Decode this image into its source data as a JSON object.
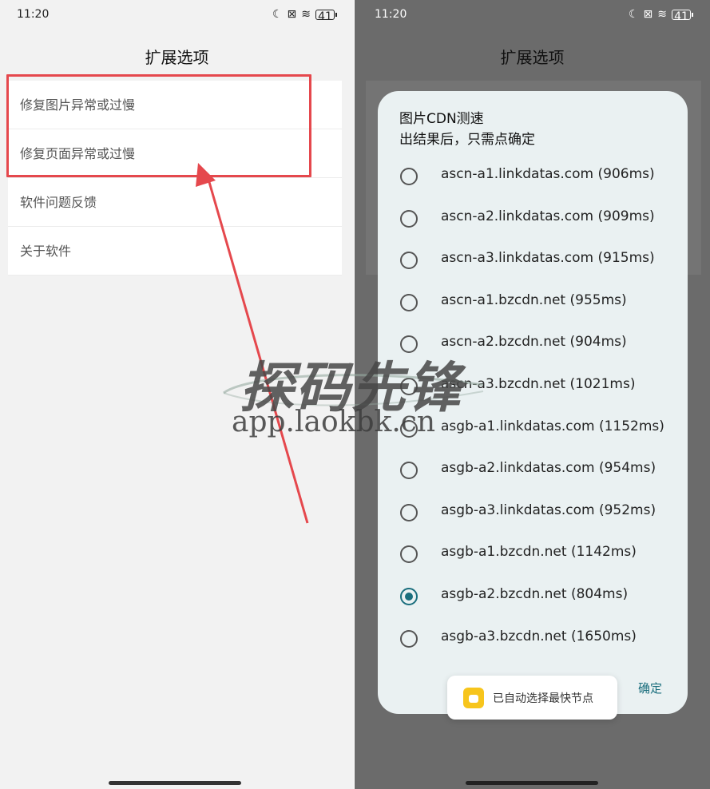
{
  "left_screen": {
    "status": {
      "time": "11:20",
      "battery": "41"
    },
    "title": "扩展选项",
    "menu": [
      {
        "label": "修复图片异常或过慢"
      },
      {
        "label": "修复页面异常或过慢"
      },
      {
        "label": "软件问题反馈"
      },
      {
        "label": "关于软件"
      }
    ]
  },
  "right_screen": {
    "status": {
      "time": "11:20",
      "battery": "41"
    },
    "title": "扩展选项",
    "dialog": {
      "title_line1": "图片CDN测速",
      "title_line2": "出结果后，只需点确定",
      "options": [
        {
          "label": "ascn-a1.linkdatas.com (906ms)",
          "selected": false
        },
        {
          "label": "ascn-a2.linkdatas.com (909ms)",
          "selected": false
        },
        {
          "label": "ascn-a3.linkdatas.com (915ms)",
          "selected": false
        },
        {
          "label": "ascn-a1.bzcdn.net (955ms)",
          "selected": false
        },
        {
          "label": "ascn-a2.bzcdn.net (904ms)",
          "selected": false
        },
        {
          "label": "ascn-a3.bzcdn.net (1021ms)",
          "selected": false
        },
        {
          "label": "asgb-a1.linkdatas.com (1152ms)",
          "selected": false
        },
        {
          "label": "asgb-a2.linkdatas.com (954ms)",
          "selected": false
        },
        {
          "label": "asgb-a3.linkdatas.com (952ms)",
          "selected": false
        },
        {
          "label": "asgb-a1.bzcdn.net (1142ms)",
          "selected": false
        },
        {
          "label": "asgb-a2.bzcdn.net (804ms)",
          "selected": true
        },
        {
          "label": "asgb-a3.bzcdn.net (1650ms)",
          "selected": false
        }
      ],
      "confirm_label": "确定"
    },
    "toast": {
      "text": "已自动选择最快节点"
    }
  },
  "watermark": {
    "main": "探码先锋",
    "sub": "app.laokbk.cn"
  },
  "colors": {
    "highlight": "#e5484d",
    "accent": "#1a6e7d",
    "toast_icon": "#f7c51c"
  }
}
